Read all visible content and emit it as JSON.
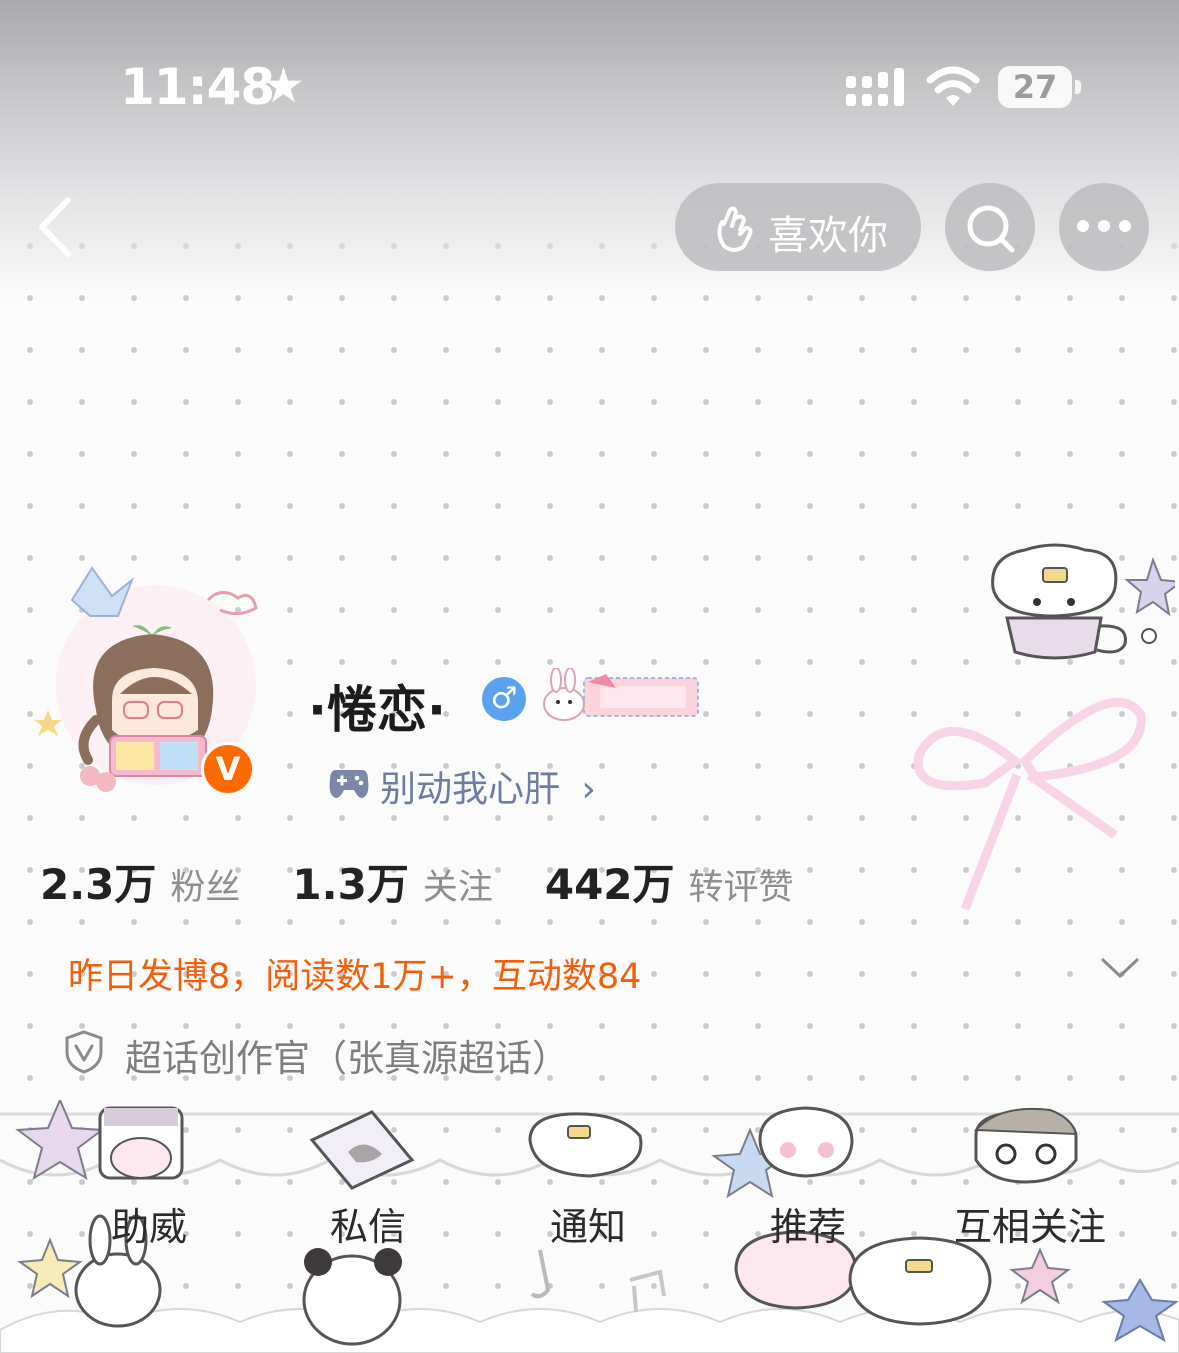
{
  "status_bar": {
    "time": "11:48",
    "battery": "27"
  },
  "nav": {
    "like_label": "喜欢你"
  },
  "profile": {
    "name": "·惓恋·",
    "gender_symbol": "♂",
    "verified_badge": "V",
    "game_tag": "别动我心肝",
    "chevron": "›"
  },
  "stats": [
    {
      "number": "2.3万",
      "label": "粉丝"
    },
    {
      "number": "1.3万",
      "label": "关注"
    },
    {
      "number": "442万",
      "label": "转评赞"
    }
  ],
  "daily_summary": "昨日发博8，阅读数1万+，互动数84",
  "super_topic": "超话创作官（张真源超话）",
  "menu": [
    "助威",
    "私信",
    "通知",
    "推荐",
    "互相关注"
  ],
  "colors": {
    "accent": "#f25f0c",
    "gender": "#5aa2ee",
    "link": "#6d7ca0",
    "badge": "#ff6a00"
  }
}
